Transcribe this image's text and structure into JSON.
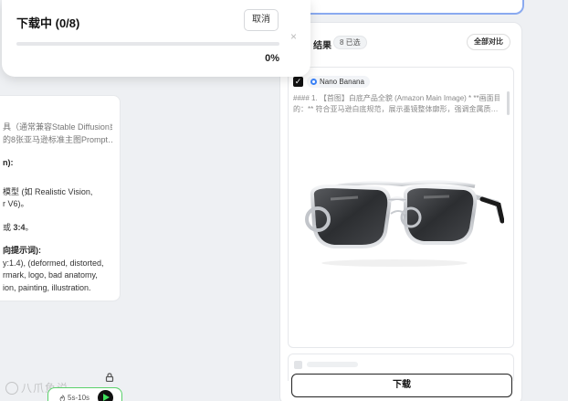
{
  "popover": {
    "title": "下载中 (0/8)",
    "cancel_label": "取消",
    "close_glyph": "×",
    "progress_label": "0%",
    "progress_fraction": 0
  },
  "left_panel": {
    "lines": [
      "具（通常兼容Stable Diffusion或",
      "的8张亚马逊标准主图Prompt…",
      "n):",
      "模型 (如 Realistic Vision,",
      "r V6)。",
      "或 3:4。",
      "向提示词):",
      "y:1.4), (deformed, distorted,",
      "rmark, logo, bad anatomy,",
      "ion, painting, illustration."
    ],
    "bold_ratio": "3:4"
  },
  "results": {
    "title": "结果",
    "selected_badge": "8 已选",
    "compare_label": "全部对比",
    "card": {
      "check_glyph": "✓",
      "model_name": "Nano Banana",
      "prompt_line1": "#### 1. 【首图】白底产品全貌 (Amazon Main Image) * **画面目",
      "prompt_line2": "的：** 符合亚马逊白底规范，展示墨镜整体廓形，强调金属质…"
    },
    "download_label": "下载"
  },
  "floating": {
    "watermark_text": "八爪鱼说",
    "duration_label": "5s-10s"
  },
  "colors": {
    "accent": "#3b82f6",
    "play_green": "#3ee05c",
    "pill_border": "#5ad16a"
  }
}
